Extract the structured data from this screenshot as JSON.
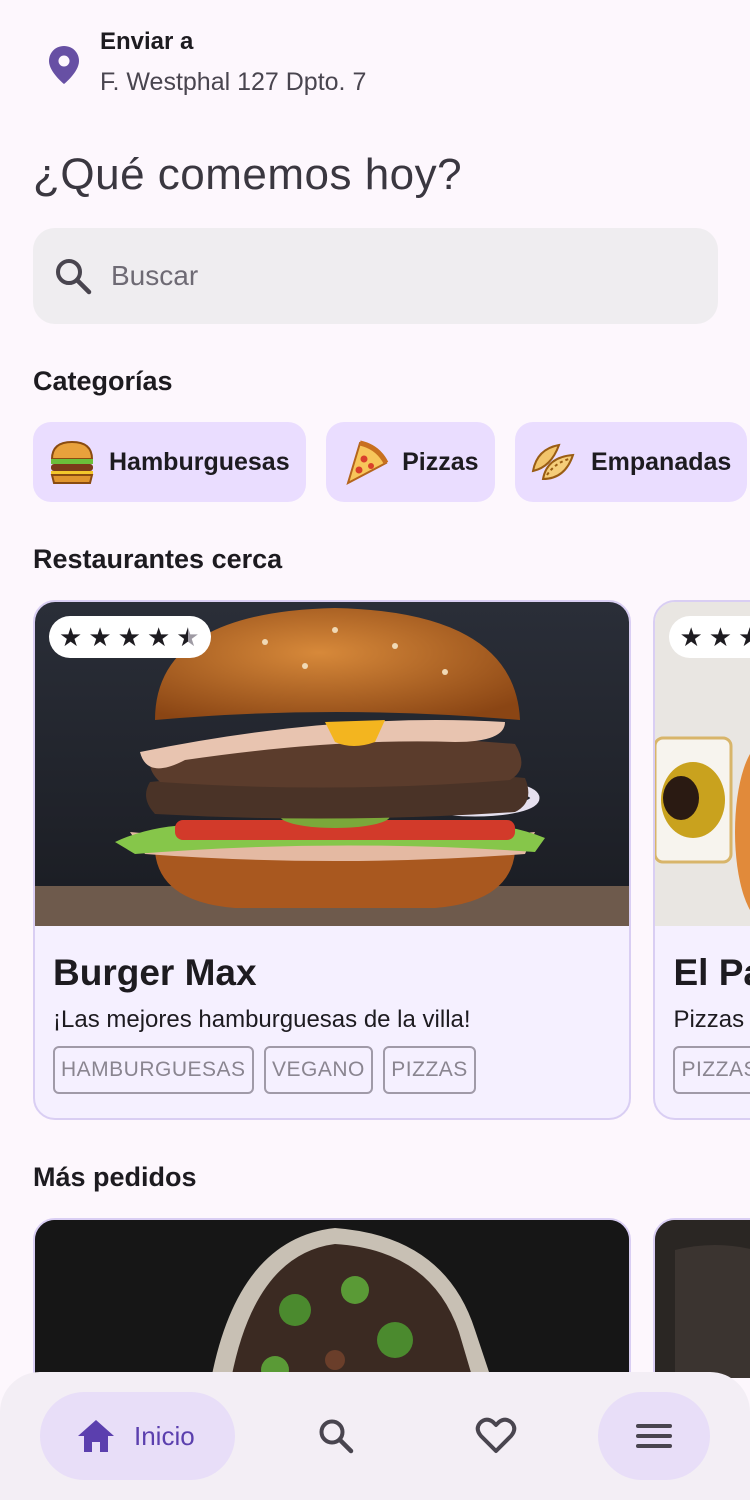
{
  "header": {
    "ship_label": "Enviar a",
    "address": "F. Westphal 127 Dpto. 7",
    "title": "¿Qué comemos hoy?"
  },
  "search": {
    "placeholder": "Buscar",
    "value": ""
  },
  "categories": {
    "title": "Categorías",
    "items": [
      {
        "label": "Hamburguesas",
        "icon": "burger-icon"
      },
      {
        "label": "Pizzas",
        "icon": "pizza-icon"
      },
      {
        "label": "Empanadas",
        "icon": "empanada-icon"
      }
    ]
  },
  "restaurants": {
    "title": "Restaurantes cerca",
    "items": [
      {
        "name": "Burger Max",
        "description": "¡Las mejores hamburguesas de la villa!",
        "rating": 4.5,
        "tags": [
          "HAMBURGUESAS",
          "VEGANO",
          "PIZZAS"
        ]
      },
      {
        "name": "El Pa",
        "description": "Pizzas",
        "rating": 3,
        "tags": [
          "PIZZAS"
        ]
      }
    ]
  },
  "popular": {
    "title": "Más pedidos"
  },
  "nav": {
    "home_label": "Inicio",
    "items": [
      "home-icon",
      "search-icon",
      "heart-icon",
      "menu-icon"
    ]
  },
  "colors": {
    "accent": "#6750a4",
    "chip": "#eaddff",
    "card": "#f5f0ff",
    "background": "#fdf7fd"
  }
}
